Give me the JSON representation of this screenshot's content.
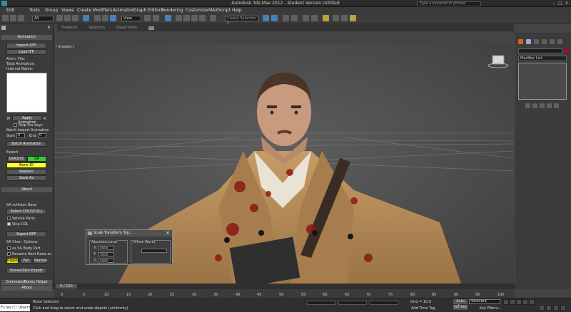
{
  "window": {
    "title": "Autodesk 3ds Max  2012 - Student Version   Untitled",
    "search_placeholder": "Type a keyword or phrase",
    "min": "–",
    "max": "□",
    "close": "×"
  },
  "menu": {
    "items": [
      "Edit",
      "Tools",
      "Group",
      "Views",
      "Create",
      "Modifiers",
      "Animation",
      "Graph Editors",
      "Rendering",
      "Customize",
      "MAXScript",
      "Help"
    ]
  },
  "toolbar": {
    "select_filter": "All",
    "view_dropdown": "View",
    "selection_set": "Create Selection S"
  },
  "ribbon": {
    "tabs": [
      "Freeform",
      "Selection",
      "Object Paint"
    ]
  },
  "left": {
    "rollout_animation": "Animation",
    "import_dff": "Import DFF",
    "load_ifp": "Load IFP",
    "anim_file": "Anim. File:",
    "total_animation": "Total Animation:",
    "internal_name": "Internal Name:",
    "m": "M",
    "apply_animation": "Apply Animation",
    "r": "R",
    "skip_pos_keys": "Skip Pos keys",
    "batch_import": "Batch Import Animation",
    "start": "Start",
    "start_val": "0",
    "end": "End",
    "end_val": "0",
    "batch_animation": "Batch Animation",
    "export": "Export",
    "gta3vc": "GTA3/VC",
    "sa": "SA",
    "bone_id": "Bone ID",
    "replace": "Replace",
    "save_as": "Save As",
    "rollout_about": "About",
    "collision_base": "SA collision Base",
    "select_col": "Select COL3/COLL",
    "vehicle_parts": "Vehicle Parts",
    "skip_col": "Skip COL",
    "export_dff": "Export DFF",
    "char_options": "SA Char.. Options",
    "as_sa_body": "as SA Body Part",
    "rename_root": "Rename Root Bone as",
    "ripped": "Ripped",
    "fat": "Fat",
    "normal": "Normal",
    "bones_skin_export": "Bones/Skin Export",
    "dummies_bones": "Dummies/Bones Helper",
    "about2": "About"
  },
  "viewport": {
    "label": "[ Shaded ]"
  },
  "right": {
    "modifier_list": "Modifier List"
  },
  "dialog": {
    "title": "Scale Transform Typ...",
    "absolute_local": "Absolute:Local",
    "offset_world": "Offset:World",
    "x": "X:",
    "y": "Y:",
    "z": "Z:",
    "xv": "100.0",
    "yv": "100.0",
    "zv": "100.0"
  },
  "timeline": {
    "position": "0 / 100",
    "ticks": [
      "0",
      "5",
      "10",
      "15",
      "20",
      "25",
      "30",
      "35",
      "40",
      "45",
      "50",
      "55",
      "60",
      "65",
      "70",
      "75",
      "80",
      "85",
      "90",
      "95",
      "100"
    ]
  },
  "status": {
    "maxscript": "Files:C:\\Users\\",
    "selection_info": "None Selected",
    "prompt": "Click and drag to select and scale objects (uniformly)",
    "grid": "Grid = 10.0",
    "add_time_tag": "Add Time Tag",
    "auto_key": "Auto Key",
    "set_key": "Set Key",
    "selected": "Selected",
    "key_filters": "Key Filters..."
  },
  "colors": {
    "sa_green": "#2fd12f",
    "bone_yellow": "#ffff22",
    "ripped_yellow": "#e8e000",
    "jacket": "#b98e5c",
    "blood": "#8a1a12"
  }
}
